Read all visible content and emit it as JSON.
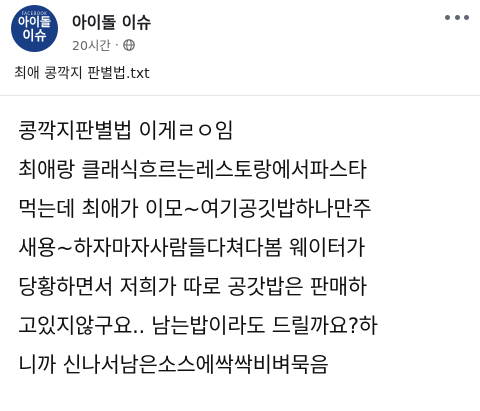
{
  "page": {
    "avatar": {
      "brand": "FACEBOOK",
      "line1": "아이돌",
      "line2": "이슈"
    },
    "name": "아이돌 이슈",
    "time": "20시간",
    "separator": "·",
    "privacy_icon": "globe-icon",
    "more_icon": "more-options-icon"
  },
  "post": {
    "caption": "최애 콩깍지 판별법.txt",
    "lines": [
      "콩깍지판별법 이게ㄹㅇ임",
      "최애랑 클래식흐르는레스토랑에서파스타",
      "먹는데 최애가 이모~여기공깃밥하나만주",
      "새용~하자마자사람들다쳐다봄 웨이터가",
      "당황하면서 저희가 따로 공갓밥은 판매하",
      "고있지않구요.. 남는밥이라도 드릴까요?하",
      "니까 신나서남은소스에싹싹비벼묵음"
    ]
  }
}
